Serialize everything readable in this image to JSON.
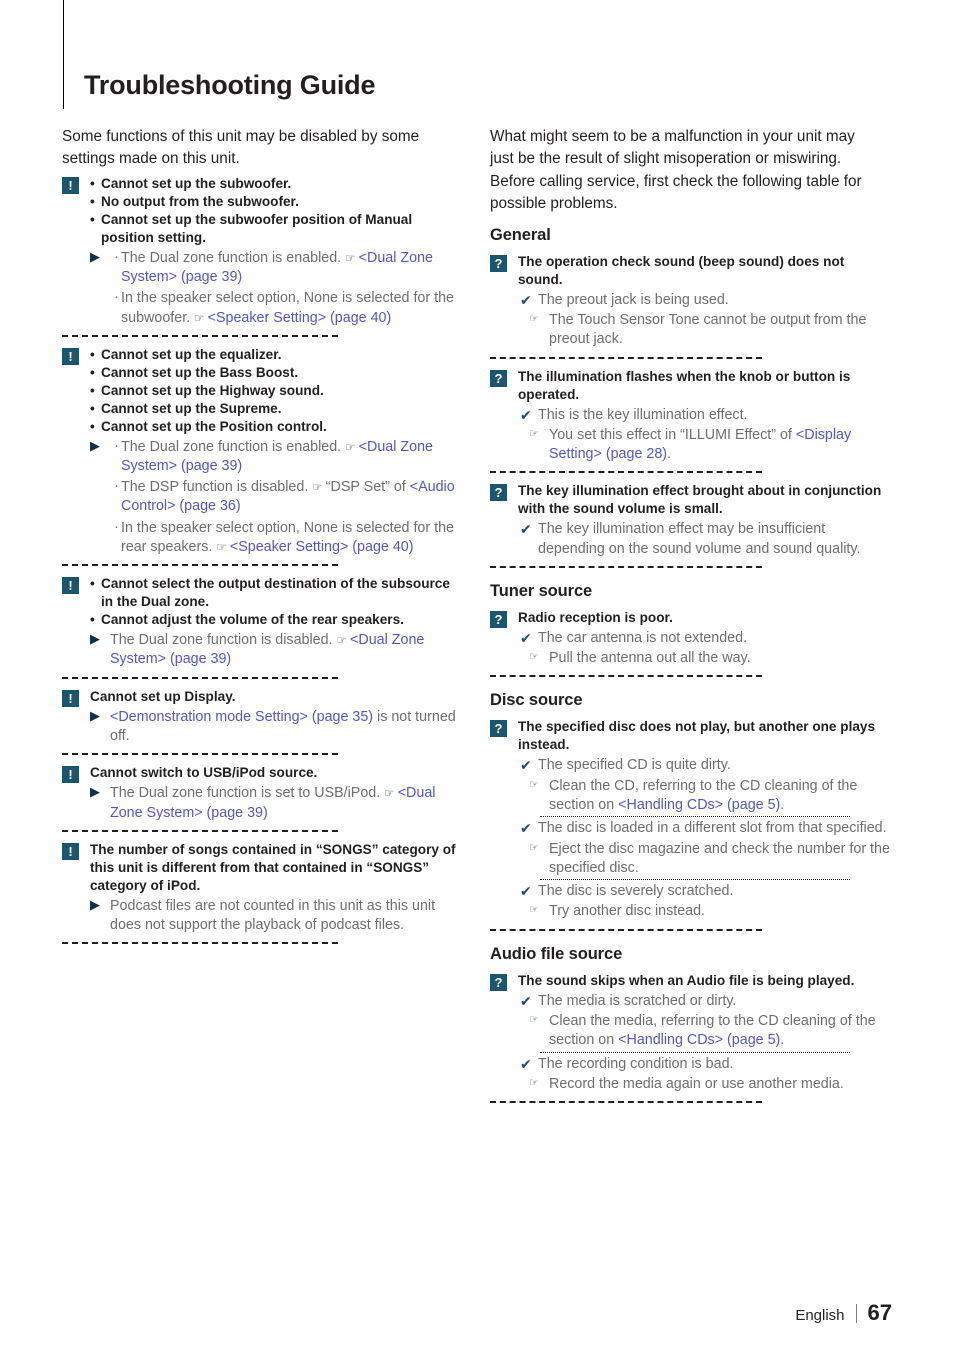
{
  "page": {
    "title": "Troubleshooting Guide",
    "footer": {
      "language": "English",
      "page_number": "67"
    },
    "colors": {
      "badge": "#1d546e",
      "link": "#5257c4",
      "body_text": "#6d6e71",
      "heading": "#231f20"
    }
  },
  "left_column": {
    "intro": "Some functions of this unit may be disabled by some settings made on this unit.",
    "entries": [
      {
        "badge": "!",
        "questions": [
          "Cannot set up the subwoofer.",
          "No output from the subwoofer.",
          "Cannot set up the subwoofer position of Manual position setting."
        ],
        "answers": [
          {
            "marker": "arrow-dot",
            "parts": [
              {
                "t": "The Dual zone function is enabled. ",
                "k": "plain"
              },
              {
                "t": "☞ ",
                "k": "hand"
              },
              {
                "t": "<Dual Zone System> (page 39)",
                "k": "link"
              }
            ]
          },
          {
            "marker": "dot",
            "parts": [
              {
                "t": "In the speaker select option, None is selected for the subwoofer. ",
                "k": "plain"
              },
              {
                "t": "☞ ",
                "k": "hand"
              },
              {
                "t": "<Speaker Setting> (page 40)",
                "k": "link"
              }
            ]
          }
        ]
      },
      {
        "badge": "!",
        "questions": [
          "Cannot set up the equalizer.",
          "Cannot set up the Bass Boost.",
          "Cannot set up the Highway sound.",
          "Cannot set up the Supreme.",
          "Cannot set up the Position control."
        ],
        "answers": [
          {
            "marker": "arrow-dot",
            "parts": [
              {
                "t": "The Dual zone function is enabled. ",
                "k": "plain"
              },
              {
                "t": "☞ ",
                "k": "hand"
              },
              {
                "t": "<Dual Zone System> (page 39)",
                "k": "link"
              }
            ]
          },
          {
            "marker": "dot",
            "parts": [
              {
                "t": "The DSP function is disabled. ",
                "k": "plain"
              },
              {
                "t": "☞ ",
                "k": "hand"
              },
              {
                "t": "“DSP Set” of ",
                "k": "plain"
              },
              {
                "t": "<Audio Control> (page 36)",
                "k": "link"
              }
            ]
          },
          {
            "marker": "dot",
            "parts": [
              {
                "t": "In the speaker select option, None is selected for the rear speakers. ",
                "k": "plain"
              },
              {
                "t": "☞ ",
                "k": "hand"
              },
              {
                "t": "<Speaker Setting> (page 40)",
                "k": "link"
              }
            ]
          }
        ]
      },
      {
        "badge": "!",
        "questions": [
          "Cannot select the output destination of the subsource in the Dual zone.",
          "Cannot adjust the volume of the rear speakers."
        ],
        "answers": [
          {
            "marker": "arrow",
            "parts": [
              {
                "t": "The Dual zone function is disabled. ",
                "k": "plain"
              },
              {
                "t": "☞ ",
                "k": "hand"
              },
              {
                "t": "<Dual Zone System> (page 39)",
                "k": "link"
              }
            ]
          }
        ]
      },
      {
        "badge": "!",
        "questions": [
          "Cannot set up Display."
        ],
        "answers": [
          {
            "marker": "arrow",
            "parts": [
              {
                "t": "<Demonstration mode Setting> (page 35)",
                "k": "link"
              },
              {
                "t": " is not turned off.",
                "k": "plain"
              }
            ]
          }
        ]
      },
      {
        "badge": "!",
        "questions": [
          "Cannot switch to USB/iPod source."
        ],
        "answers": [
          {
            "marker": "arrow",
            "parts": [
              {
                "t": "The Dual zone function is set to USB/iPod. ",
                "k": "plain"
              },
              {
                "t": "☞ ",
                "k": "hand"
              },
              {
                "t": "<Dual Zone System> (page 39)",
                "k": "link"
              }
            ]
          }
        ]
      },
      {
        "badge": "!",
        "questions": [
          "The number of songs contained in “SONGS” category of this unit is different from that contained in “SONGS” category of iPod."
        ],
        "answers": [
          {
            "marker": "arrow",
            "parts": [
              {
                "t": "Podcast files are not counted in this unit as this unit does not support the playback of podcast files.",
                "k": "plain"
              }
            ]
          }
        ]
      }
    ]
  },
  "right_column": {
    "intro": "What might seem to be a malfunction in your unit may just be the result of slight misoperation or miswiring. Before calling service, first check the following table for possible problems.",
    "sections": [
      {
        "heading": "General",
        "entries": [
          {
            "badge": "?",
            "questions": [
              "The operation check sound (beep sound) does not sound."
            ],
            "answers": [
              {
                "marker": "check",
                "parts": [
                  {
                    "t": "The preout jack is being used.",
                    "k": "plain"
                  }
                ]
              },
              {
                "marker": "hand",
                "parts": [
                  {
                    "t": "The Touch Sensor Tone cannot be output from the preout jack.",
                    "k": "plain"
                  }
                ]
              }
            ]
          },
          {
            "badge": "?",
            "questions": [
              "The illumination flashes when the knob or button is operated."
            ],
            "answers": [
              {
                "marker": "check",
                "parts": [
                  {
                    "t": "This is the key illumination effect.",
                    "k": "plain"
                  }
                ]
              },
              {
                "marker": "hand",
                "parts": [
                  {
                    "t": "You set this effect in “ILLUMI Effect” of ",
                    "k": "plain"
                  },
                  {
                    "t": "<Display Setting> (page 28)",
                    "k": "link"
                  },
                  {
                    "t": ".",
                    "k": "plain"
                  }
                ]
              }
            ]
          },
          {
            "badge": "?",
            "questions": [
              "The key illumination effect brought about in conjunction with the sound volume is small."
            ],
            "answers": [
              {
                "marker": "check",
                "parts": [
                  {
                    "t": "The key illumination effect may be insufficient depending on the sound volume and sound quality.",
                    "k": "plain"
                  }
                ]
              }
            ]
          }
        ]
      },
      {
        "heading": "Tuner source",
        "entries": [
          {
            "badge": "?",
            "questions": [
              "Radio reception is poor."
            ],
            "answers": [
              {
                "marker": "check",
                "parts": [
                  {
                    "t": "The car antenna is not extended.",
                    "k": "plain"
                  }
                ]
              },
              {
                "marker": "hand",
                "parts": [
                  {
                    "t": "Pull the antenna out all the way.",
                    "k": "plain"
                  }
                ]
              }
            ]
          }
        ]
      },
      {
        "heading": "Disc source",
        "entries": [
          {
            "badge": "?",
            "questions": [
              "The specified disc does not play, but another one plays instead."
            ],
            "answers": [
              {
                "marker": "check",
                "parts": [
                  {
                    "t": "The specified CD is quite dirty.",
                    "k": "plain"
                  }
                ]
              },
              {
                "marker": "hand",
                "parts": [
                  {
                    "t": "Clean the CD, referring to the CD cleaning of the section on ",
                    "k": "plain"
                  },
                  {
                    "t": "<Handling CDs> (page 5)",
                    "k": "link"
                  },
                  {
                    "t": ".",
                    "k": "plain"
                  }
                ]
              },
              {
                "marker": "thin-sep",
                "parts": []
              },
              {
                "marker": "check",
                "parts": [
                  {
                    "t": "The disc is loaded in a different slot from that specified.",
                    "k": "plain"
                  }
                ]
              },
              {
                "marker": "hand",
                "parts": [
                  {
                    "t": "Eject the disc magazine and check the number for the specified disc.",
                    "k": "plain"
                  }
                ]
              },
              {
                "marker": "thin-sep",
                "parts": []
              },
              {
                "marker": "check",
                "parts": [
                  {
                    "t": "The disc is severely scratched.",
                    "k": "plain"
                  }
                ]
              },
              {
                "marker": "hand",
                "parts": [
                  {
                    "t": "Try another disc instead.",
                    "k": "plain"
                  }
                ]
              }
            ]
          }
        ]
      },
      {
        "heading": "Audio file source",
        "entries": [
          {
            "badge": "?",
            "questions": [
              "The sound skips when an Audio file is being played."
            ],
            "answers": [
              {
                "marker": "check",
                "parts": [
                  {
                    "t": "The media is scratched or dirty.",
                    "k": "plain"
                  }
                ]
              },
              {
                "marker": "hand",
                "parts": [
                  {
                    "t": "Clean the media, referring to the CD cleaning of the section on ",
                    "k": "plain"
                  },
                  {
                    "t": "<Handling CDs> (page 5)",
                    "k": "link"
                  },
                  {
                    "t": ".",
                    "k": "plain"
                  }
                ]
              },
              {
                "marker": "thin-sep",
                "parts": []
              },
              {
                "marker": "check",
                "parts": [
                  {
                    "t": "The recording condition is bad.",
                    "k": "plain"
                  }
                ]
              },
              {
                "marker": "hand",
                "parts": [
                  {
                    "t": "Record the media again or use another media.",
                    "k": "plain"
                  }
                ]
              }
            ]
          }
        ]
      }
    ]
  }
}
